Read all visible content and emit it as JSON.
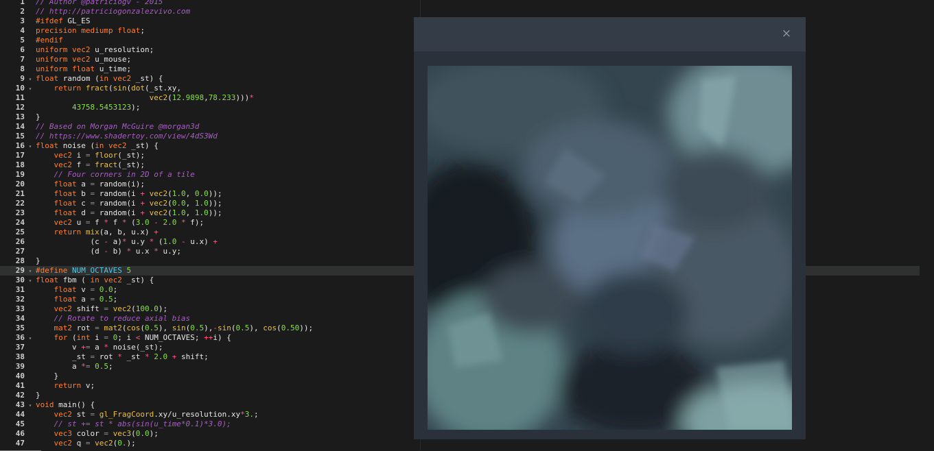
{
  "editor": {
    "active_line": 29,
    "lines": [
      [
        [
          "c",
          "// Author @patriciogv - 2015"
        ]
      ],
      [
        [
          "c",
          "// http://patriciogonzalezvivo.com"
        ]
      ],
      [
        [
          "k",
          "#ifdef"
        ],
        [
          "p",
          " GL_ES"
        ]
      ],
      [
        [
          "k",
          "precision mediump float"
        ],
        [
          "p",
          ";"
        ]
      ],
      [
        [
          "k",
          "#endif"
        ]
      ],
      [
        [
          "k",
          "uniform vec2"
        ],
        [
          "p",
          " u_resolution;"
        ]
      ],
      [
        [
          "k",
          "uniform vec2"
        ],
        [
          "p",
          " u_mouse;"
        ]
      ],
      [
        [
          "k",
          "uniform float"
        ],
        [
          "p",
          " u_time;"
        ]
      ],
      [
        [
          "k",
          "float"
        ],
        [
          "p",
          " random ("
        ],
        [
          "k",
          "in vec2"
        ],
        [
          "p",
          " _st) {"
        ]
      ],
      [
        [
          "p",
          "    "
        ],
        [
          "k",
          "return"
        ],
        [
          "p",
          " "
        ],
        [
          "f",
          "fract"
        ],
        [
          "p",
          "("
        ],
        [
          "f",
          "sin"
        ],
        [
          "p",
          "("
        ],
        [
          "f",
          "dot"
        ],
        [
          "p",
          "(_st.xy,"
        ]
      ],
      [
        [
          "p",
          "                         "
        ],
        [
          "f",
          "vec2"
        ],
        [
          "p",
          "("
        ],
        [
          "n",
          "12.9898"
        ],
        [
          "p",
          ","
        ],
        [
          "n",
          "78.233"
        ],
        [
          "p",
          ")))"
        ],
        [
          "o",
          "*"
        ]
      ],
      [
        [
          "p",
          "        "
        ],
        [
          "n",
          "43758.5453123"
        ],
        [
          "p",
          ");"
        ]
      ],
      [
        [
          "p",
          "}"
        ]
      ],
      [
        [
          "c",
          "// Based on Morgan McGuire @morgan3d"
        ]
      ],
      [
        [
          "c",
          "// https://www.shadertoy.com/view/4dS3Wd"
        ]
      ],
      [
        [
          "k",
          "float"
        ],
        [
          "p",
          " noise ("
        ],
        [
          "k",
          "in vec2"
        ],
        [
          "p",
          " _st) {"
        ]
      ],
      [
        [
          "p",
          "    "
        ],
        [
          "k",
          "vec2"
        ],
        [
          "p",
          " i "
        ],
        [
          "o",
          "="
        ],
        [
          "p",
          " "
        ],
        [
          "f",
          "floor"
        ],
        [
          "p",
          "(_st);"
        ]
      ],
      [
        [
          "p",
          "    "
        ],
        [
          "k",
          "vec2"
        ],
        [
          "p",
          " f "
        ],
        [
          "o",
          "="
        ],
        [
          "p",
          " "
        ],
        [
          "f",
          "fract"
        ],
        [
          "p",
          "(_st);"
        ]
      ],
      [
        [
          "p",
          "    "
        ],
        [
          "c",
          "// Four corners in 2D of a tile"
        ]
      ],
      [
        [
          "p",
          "    "
        ],
        [
          "k",
          "float"
        ],
        [
          "p",
          " a "
        ],
        [
          "o",
          "="
        ],
        [
          "p",
          " random(i);"
        ]
      ],
      [
        [
          "p",
          "    "
        ],
        [
          "k",
          "float"
        ],
        [
          "p",
          " b "
        ],
        [
          "o",
          "="
        ],
        [
          "p",
          " random(i "
        ],
        [
          "o",
          "+"
        ],
        [
          "p",
          " "
        ],
        [
          "f",
          "vec2"
        ],
        [
          "p",
          "("
        ],
        [
          "n",
          "1.0"
        ],
        [
          "p",
          ", "
        ],
        [
          "n",
          "0.0"
        ],
        [
          "p",
          "));"
        ]
      ],
      [
        [
          "p",
          "    "
        ],
        [
          "k",
          "float"
        ],
        [
          "p",
          " c "
        ],
        [
          "o",
          "="
        ],
        [
          "p",
          " random(i "
        ],
        [
          "o",
          "+"
        ],
        [
          "p",
          " "
        ],
        [
          "f",
          "vec2"
        ],
        [
          "p",
          "("
        ],
        [
          "n",
          "0.0"
        ],
        [
          "p",
          ", "
        ],
        [
          "n",
          "1.0"
        ],
        [
          "p",
          "));"
        ]
      ],
      [
        [
          "p",
          "    "
        ],
        [
          "k",
          "float"
        ],
        [
          "p",
          " d "
        ],
        [
          "o",
          "="
        ],
        [
          "p",
          " random(i "
        ],
        [
          "o",
          "+"
        ],
        [
          "p",
          " "
        ],
        [
          "f",
          "vec2"
        ],
        [
          "p",
          "("
        ],
        [
          "n",
          "1.0"
        ],
        [
          "p",
          ", "
        ],
        [
          "n",
          "1.0"
        ],
        [
          "p",
          "));"
        ]
      ],
      [
        [
          "p",
          "    "
        ],
        [
          "k",
          "vec2"
        ],
        [
          "p",
          " u "
        ],
        [
          "o",
          "="
        ],
        [
          "p",
          " f "
        ],
        [
          "o",
          "*"
        ],
        [
          "p",
          " f "
        ],
        [
          "o",
          "*"
        ],
        [
          "p",
          " ("
        ],
        [
          "n",
          "3.0"
        ],
        [
          "p",
          " "
        ],
        [
          "o",
          "-"
        ],
        [
          "p",
          " "
        ],
        [
          "n",
          "2.0"
        ],
        [
          "p",
          " "
        ],
        [
          "o",
          "*"
        ],
        [
          "p",
          " f);"
        ]
      ],
      [
        [
          "p",
          "    "
        ],
        [
          "k",
          "return"
        ],
        [
          "p",
          " "
        ],
        [
          "f",
          "mix"
        ],
        [
          "p",
          "(a, b, u.x) "
        ],
        [
          "o",
          "+"
        ]
      ],
      [
        [
          "p",
          "            (c "
        ],
        [
          "o",
          "-"
        ],
        [
          "p",
          " a)"
        ],
        [
          "o",
          "*"
        ],
        [
          "p",
          " u.y "
        ],
        [
          "o",
          "*"
        ],
        [
          "p",
          " ("
        ],
        [
          "n",
          "1.0"
        ],
        [
          "p",
          " "
        ],
        [
          "o",
          "-"
        ],
        [
          "p",
          " u.x) "
        ],
        [
          "o",
          "+"
        ]
      ],
      [
        [
          "p",
          "            (d "
        ],
        [
          "o",
          "-"
        ],
        [
          "p",
          " b) "
        ],
        [
          "o",
          "*"
        ],
        [
          "p",
          " u.x "
        ],
        [
          "o",
          "*"
        ],
        [
          "p",
          " u.y;"
        ]
      ],
      [
        [
          "p",
          "}"
        ]
      ],
      [
        [
          "k",
          "#define"
        ],
        [
          "p",
          " "
        ],
        [
          "m",
          "NUM_OCTAVES"
        ],
        [
          "p",
          " "
        ],
        [
          "n",
          "5"
        ]
      ],
      [
        [
          "k",
          "float"
        ],
        [
          "p",
          " fbm ( "
        ],
        [
          "k",
          "in vec2"
        ],
        [
          "p",
          " _st) {"
        ]
      ],
      [
        [
          "p",
          "    "
        ],
        [
          "k",
          "float"
        ],
        [
          "p",
          " v "
        ],
        [
          "o",
          "="
        ],
        [
          "p",
          " "
        ],
        [
          "n",
          "0.0"
        ],
        [
          "p",
          ";"
        ]
      ],
      [
        [
          "p",
          "    "
        ],
        [
          "k",
          "float"
        ],
        [
          "p",
          " a "
        ],
        [
          "o",
          "="
        ],
        [
          "p",
          " "
        ],
        [
          "n",
          "0.5"
        ],
        [
          "p",
          ";"
        ]
      ],
      [
        [
          "p",
          "    "
        ],
        [
          "k",
          "vec2"
        ],
        [
          "p",
          " shift "
        ],
        [
          "o",
          "="
        ],
        [
          "p",
          " "
        ],
        [
          "f",
          "vec2"
        ],
        [
          "p",
          "("
        ],
        [
          "n",
          "100.0"
        ],
        [
          "p",
          ");"
        ]
      ],
      [
        [
          "p",
          "    "
        ],
        [
          "c",
          "// Rotate to reduce axial bias"
        ]
      ],
      [
        [
          "p",
          "    "
        ],
        [
          "k",
          "mat2"
        ],
        [
          "p",
          " rot "
        ],
        [
          "o",
          "="
        ],
        [
          "p",
          " "
        ],
        [
          "f",
          "mat2"
        ],
        [
          "p",
          "("
        ],
        [
          "f",
          "cos"
        ],
        [
          "p",
          "("
        ],
        [
          "n",
          "0.5"
        ],
        [
          "p",
          "), "
        ],
        [
          "f",
          "sin"
        ],
        [
          "p",
          "("
        ],
        [
          "n",
          "0.5"
        ],
        [
          "p",
          "),"
        ],
        [
          "o",
          "-"
        ],
        [
          "f",
          "sin"
        ],
        [
          "p",
          "("
        ],
        [
          "n",
          "0.5"
        ],
        [
          "p",
          "), "
        ],
        [
          "f",
          "cos"
        ],
        [
          "p",
          "("
        ],
        [
          "n",
          "0.50"
        ],
        [
          "p",
          "));"
        ]
      ],
      [
        [
          "p",
          "    "
        ],
        [
          "k",
          "for"
        ],
        [
          "p",
          " ("
        ],
        [
          "k",
          "int"
        ],
        [
          "p",
          " i "
        ],
        [
          "o",
          "="
        ],
        [
          "p",
          " "
        ],
        [
          "n",
          "0"
        ],
        [
          "p",
          "; i "
        ],
        [
          "o",
          "<"
        ],
        [
          "p",
          " NUM_OCTAVES; "
        ],
        [
          "o",
          "++"
        ],
        [
          "p",
          "i) {"
        ]
      ],
      [
        [
          "p",
          "        v "
        ],
        [
          "o",
          "+="
        ],
        [
          "p",
          " a "
        ],
        [
          "o",
          "*"
        ],
        [
          "p",
          " noise(_st);"
        ]
      ],
      [
        [
          "p",
          "        _st "
        ],
        [
          "o",
          "="
        ],
        [
          "p",
          " rot "
        ],
        [
          "o",
          "*"
        ],
        [
          "p",
          " _st "
        ],
        [
          "o",
          "*"
        ],
        [
          "p",
          " "
        ],
        [
          "n",
          "2.0"
        ],
        [
          "p",
          " "
        ],
        [
          "o",
          "+"
        ],
        [
          "p",
          " shift;"
        ]
      ],
      [
        [
          "p",
          "        a "
        ],
        [
          "o",
          "*="
        ],
        [
          "p",
          " "
        ],
        [
          "n",
          "0.5"
        ],
        [
          "p",
          ";"
        ]
      ],
      [
        [
          "p",
          "    }"
        ]
      ],
      [
        [
          "p",
          "    "
        ],
        [
          "k",
          "return"
        ],
        [
          "p",
          " v;"
        ]
      ],
      [
        [
          "p",
          "}"
        ]
      ],
      [
        [
          "k",
          "void"
        ],
        [
          "p",
          " main() {"
        ]
      ],
      [
        [
          "p",
          "    "
        ],
        [
          "k",
          "vec2"
        ],
        [
          "p",
          " st "
        ],
        [
          "o",
          "="
        ],
        [
          "p",
          " "
        ],
        [
          "f",
          "gl_FragCoord"
        ],
        [
          "p",
          ".xy/u_resolution.xy"
        ],
        [
          "o",
          "*"
        ],
        [
          "n",
          "3."
        ],
        [
          "p",
          ";"
        ]
      ],
      [
        [
          "p",
          "    "
        ],
        [
          "c",
          "// st += st * abs(sin(u_time*0.1)*3.0);"
        ]
      ],
      [
        [
          "p",
          "    "
        ],
        [
          "k",
          "vec3"
        ],
        [
          "p",
          " color "
        ],
        [
          "o",
          "="
        ],
        [
          "p",
          " "
        ],
        [
          "f",
          "vec3"
        ],
        [
          "p",
          "("
        ],
        [
          "n",
          "0.0"
        ],
        [
          "p",
          ");"
        ]
      ],
      [
        [
          "p",
          "    "
        ],
        [
          "k",
          "vec2"
        ],
        [
          "p",
          " q "
        ],
        [
          "o",
          "="
        ],
        [
          "p",
          " "
        ],
        [
          "f",
          "vec2"
        ],
        [
          "p",
          "("
        ],
        [
          "n",
          "0."
        ],
        [
          "p",
          ");"
        ]
      ]
    ],
    "fold_lines": [
      9,
      10,
      16,
      29,
      30,
      36,
      43
    ]
  },
  "overlay": {
    "close_glyph": "×",
    "colors": {
      "panel": "#2a313b",
      "header": "#343c48",
      "preview_base": "#2c3b43"
    }
  }
}
